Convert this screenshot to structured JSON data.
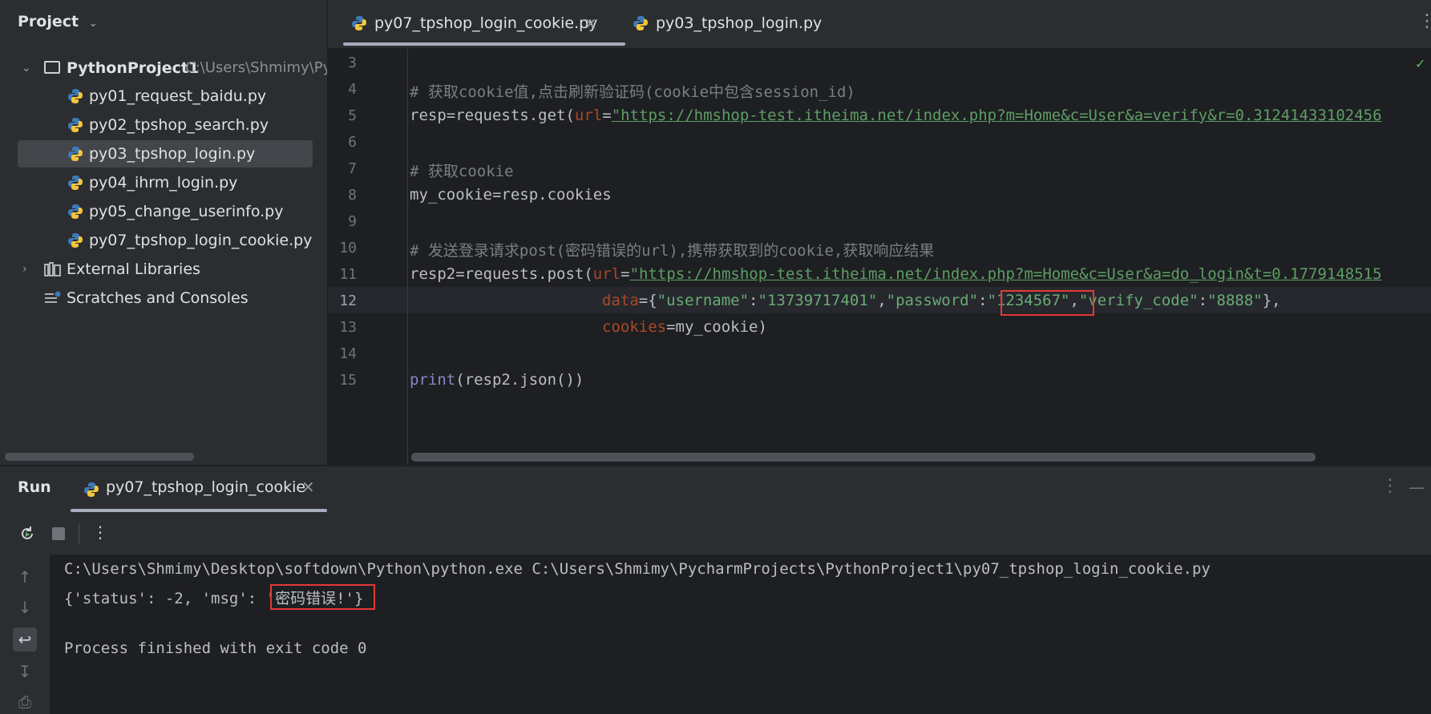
{
  "project": {
    "header": "Project",
    "root_name": "PythonProject1",
    "root_path": "C:\\Users\\Shmimy\\Pyc",
    "files": [
      "py01_request_baidu.py",
      "py02_tpshop_search.py",
      "py03_tpshop_login.py",
      "py04_ihrm_login.py",
      "py05_change_userinfo.py",
      "py07_tpshop_login_cookie.py"
    ],
    "external_libraries": "External Libraries",
    "scratches": "Scratches and Consoles"
  },
  "editor": {
    "tabs": [
      "py07_tpshop_login_cookie.py",
      "py03_tpshop_login.py"
    ],
    "line_numbers": [
      "3",
      "4",
      "5",
      "6",
      "7",
      "8",
      "9",
      "10",
      "11",
      "12",
      "13",
      "14",
      "15"
    ],
    "current_line": "12",
    "code": {
      "l4": "# 获取cookie值,点击刷新验证码(cookie中包含session_id)",
      "l5_a": "resp=requests.get(",
      "l5_param": "url",
      "l5_eq": "=",
      "l5_url": "\"https://hmshop-test.itheima.net/index.php?m=Home&c=User&a=verify&r=0.31241433102456",
      "l7": "# 获取cookie",
      "l8": "my_cookie=resp.cookies",
      "l10": "# 发送登录请求post(密码错误的url),携带获取到的cookie,获取响应结果",
      "l11_a": "resp2=requests.post(",
      "l11_param": "url",
      "l11_eq": "=",
      "l11_url": "\"https://hmshop-test.itheima.net/index.php?m=Home&c=User&a=do_login&t=0.1779148515",
      "l12_param": "data",
      "l12_a": "={",
      "l12_k1": "\"username\"",
      "l12_c1": ":",
      "l12_v1": "\"13739717401\"",
      "l12_s1": ",",
      "l12_k2": "\"password\"",
      "l12_c2": ":",
      "l12_v2": "\"1234567\"",
      "l12_s2": ",",
      "l12_k3": "\"verify_code\"",
      "l12_c3": ":",
      "l12_v3": "\"8888\"",
      "l12_end": "},",
      "l13_param": "cookies",
      "l13_rest": "=my_cookie)",
      "l15_fn": "print",
      "l15_rest": "(resp2.json())"
    }
  },
  "run": {
    "title": "Run",
    "tab": "py07_tpshop_login_cookie",
    "console": {
      "cmd": "C:\\Users\\Shmimy\\Desktop\\softdown\\Python\\python.exe C:\\Users\\Shmimy\\PycharmProjects\\PythonProject1\\py07_tpshop_login_cookie.py",
      "out_a": "{'status': -2, 'msg': ",
      "out_msg": "'密码错误!'",
      "out_end": "}",
      "finished": "Process finished with exit code 0"
    }
  },
  "colors": {
    "accent_red": "#e53935",
    "string_green": "#6aab73",
    "param_orange": "#aa4926",
    "python_blue": "#3d7ab8",
    "python_yellow": "#f2c53d"
  }
}
